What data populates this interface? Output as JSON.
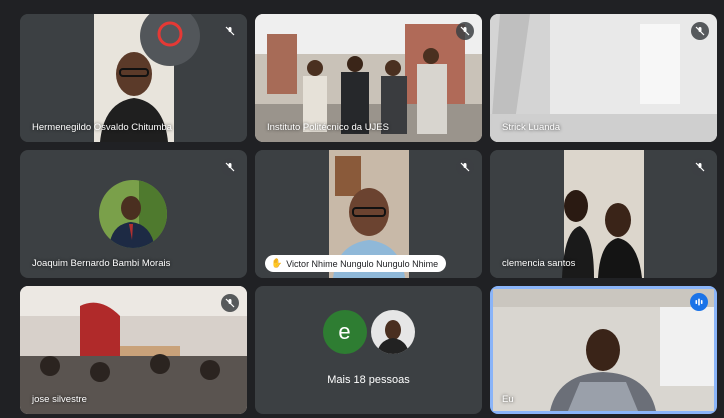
{
  "participants": [
    {
      "name": "Hermenegildo Osvaldo Chitumba",
      "muted": true
    },
    {
      "name": "Instituto Politécnico da UJES",
      "muted": true
    },
    {
      "name": "Strick Luanda",
      "muted": true
    },
    {
      "name": "Joaquim Bernardo Bambi Morais",
      "muted": true
    },
    {
      "name": "Victor Nhime Nungulo Nungulo Nhime",
      "muted": true
    },
    {
      "name": "clemencia santos",
      "muted": true
    },
    {
      "name": "jose silvestre",
      "muted": true
    },
    {
      "more_label": "Mais 18 pessoas",
      "avatar_letter": "e"
    },
    {
      "name": "Eu",
      "speaking": true
    }
  ],
  "colors": {
    "background": "#202124",
    "tile": "#3c4043",
    "active_border": "#8ab4f8",
    "speaking_indicator": "#1a73e8",
    "letter_avatar": "#2e7d32"
  },
  "icons": {
    "muted": "mic-off-icon",
    "speaking": "audio-level-icon",
    "raised_hand": "hand-icon"
  }
}
